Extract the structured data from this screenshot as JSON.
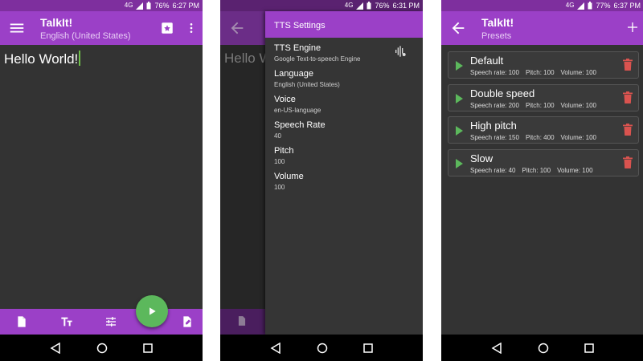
{
  "colors": {
    "primary": "#9b40c7",
    "status_bar": "#7e2f9e",
    "accent_green": "#5cb85c",
    "delete_red": "#d9534f",
    "background": "#333333"
  },
  "screens": [
    {
      "status": {
        "signal": "4G",
        "battery": "76%",
        "time": "6:27 PM"
      },
      "appbar": {
        "title": "TalkIt!",
        "subtitle": "English (United States)"
      },
      "editor": {
        "text": "Hello World!"
      },
      "bottom_icons": [
        "new-document-icon",
        "text-format-icon",
        "tune-icon",
        "edit-document-icon"
      ],
      "fab_icon": "play-icon"
    },
    {
      "status": {
        "signal": "4G",
        "battery": "76%",
        "time": "6:31 PM"
      },
      "background_text": "Hello W",
      "drawer": {
        "title": "TTS Settings",
        "settings": [
          {
            "label": "TTS Engine",
            "value": "Google Text-to-speech Engine"
          },
          {
            "label": "Language",
            "value": "English (United States)"
          },
          {
            "label": "Voice",
            "value": "en-US-language"
          },
          {
            "label": "Speech Rate",
            "value": "40"
          },
          {
            "label": "Pitch",
            "value": "100"
          },
          {
            "label": "Volume",
            "value": "100"
          }
        ]
      }
    },
    {
      "status": {
        "signal": "4G",
        "battery": "77%",
        "time": "6:37 PM"
      },
      "appbar": {
        "title": "TalkIt!",
        "subtitle": "Presets"
      },
      "presets": [
        {
          "name": "Default",
          "rate": "Speech rate: 100",
          "pitch": "Pitch: 100",
          "volume": "Volume: 100"
        },
        {
          "name": "Double speed",
          "rate": "Speech rate: 200",
          "pitch": "Pitch: 100",
          "volume": "Volume: 100"
        },
        {
          "name": "High pitch",
          "rate": "Speech rate: 150",
          "pitch": "Pitch: 400",
          "volume": "Volume: 100"
        },
        {
          "name": "Slow",
          "rate": "Speech rate:  40",
          "pitch": "Pitch: 100",
          "volume": "Volume: 100"
        }
      ]
    }
  ]
}
